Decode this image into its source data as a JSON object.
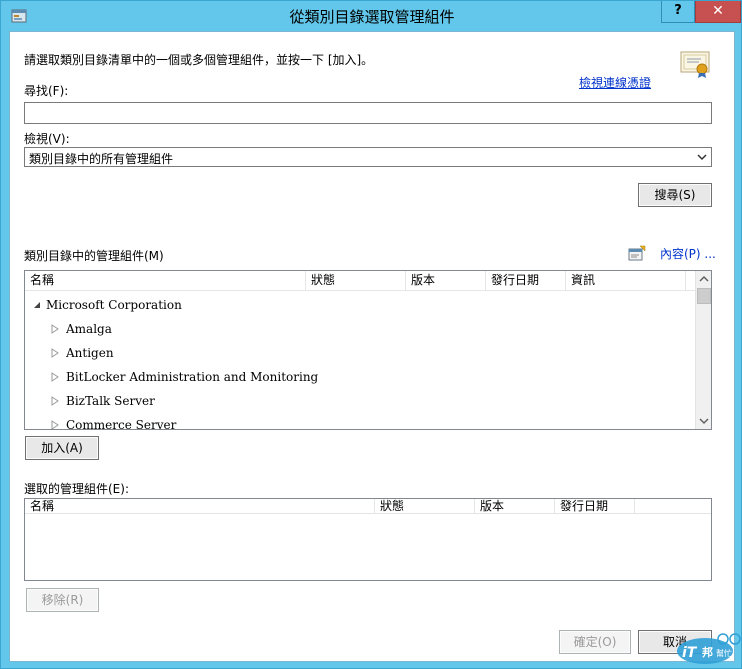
{
  "window": {
    "title": "從類別目錄選取管理組件",
    "help_label": "?",
    "close_label": "✕"
  },
  "instructions": "請選取類別目錄清單中的一個或多個管理組件，並按一下 [加入]。",
  "view_certificate_link": "檢視連線憑證",
  "find": {
    "label": "尋找(F):",
    "value": ""
  },
  "view": {
    "label": "檢視(V):",
    "selected": "類別目錄中的所有管理組件"
  },
  "search_button": "搜尋(S)",
  "catalog": {
    "label": "類別目錄中的管理組件(M)",
    "properties_link": "內容(P) ...",
    "columns": [
      "名稱",
      "狀態",
      "版本",
      "發行日期",
      "資訊"
    ],
    "tree": [
      {
        "text": "Microsoft Corporation",
        "level": 0,
        "expanded": true
      },
      {
        "text": "Amalga",
        "level": 1,
        "expanded": false
      },
      {
        "text": "Antigen",
        "level": 1,
        "expanded": false
      },
      {
        "text": "BitLocker Administration and Monitoring",
        "level": 1,
        "expanded": false
      },
      {
        "text": "BizTalk Server",
        "level": 1,
        "expanded": false
      },
      {
        "text": "Commerce Server",
        "level": 1,
        "expanded": false
      }
    ]
  },
  "add_button": "加入(A)",
  "selected": {
    "label": "選取的管理組件(E):",
    "columns": [
      "名稱",
      "狀態",
      "版本",
      "發行日期"
    ]
  },
  "remove_button": "移除(R)",
  "ok_button": "確定(O)",
  "cancel_button": "取消",
  "watermark_text": "iT邦幫忙",
  "colors": {
    "titlebar": "#62c7ea",
    "close": "#c75050",
    "link": "#0033cc"
  },
  "icons": {
    "app": "window-icon",
    "certificate": "certificate-icon",
    "properties": "properties-icon",
    "expand": "triangle-right-icon",
    "collapse": "triangle-down-icon"
  }
}
